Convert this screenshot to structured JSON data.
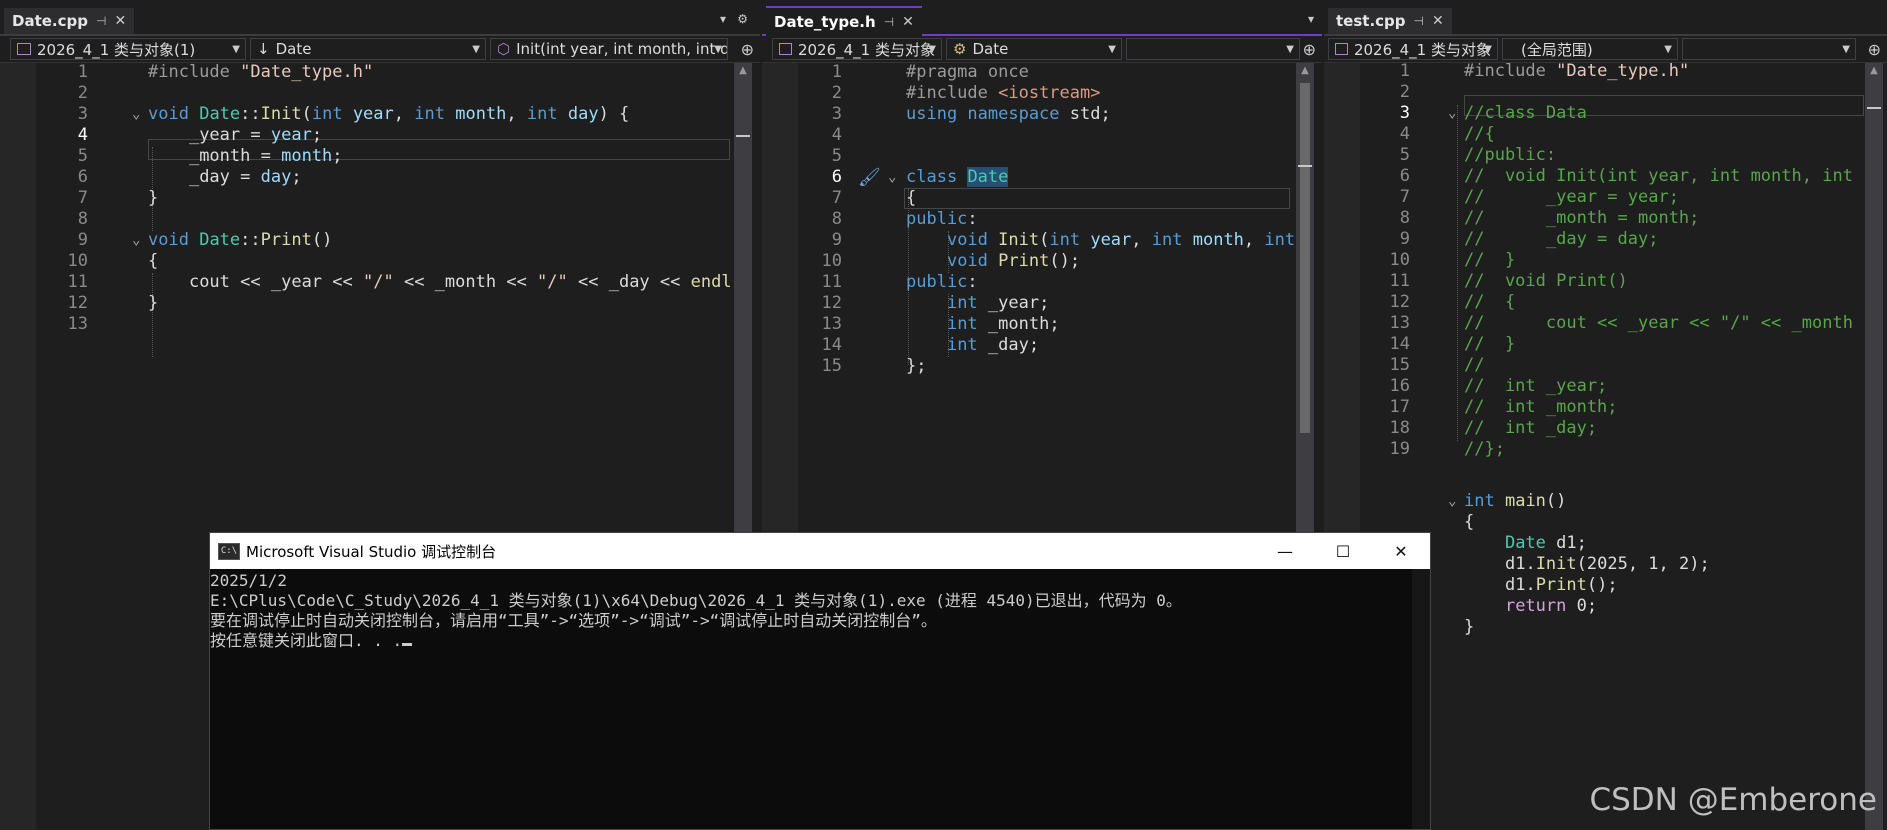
{
  "pane1": {
    "tab_title": "Date.cpp",
    "nav": {
      "project": "2026_4_1 类与对象(1)",
      "scope": "Date",
      "member": "Init(int year, int month, int d"
    },
    "lines": [
      {
        "n": "1",
        "t": "#include \"Date_type.h\""
      },
      {
        "n": "2",
        "t": ""
      },
      {
        "n": "3",
        "t": "void Date::Init(int year, int month, int day) {"
      },
      {
        "n": "4",
        "t": "    _year = year;"
      },
      {
        "n": "5",
        "t": "    _month = month;"
      },
      {
        "n": "6",
        "t": "    _day = day;"
      },
      {
        "n": "7",
        "t": "}"
      },
      {
        "n": "8",
        "t": ""
      },
      {
        "n": "9",
        "t": "void Date::Print()"
      },
      {
        "n": "10",
        "t": "{"
      },
      {
        "n": "11",
        "t": "    cout << _year << \"/\" << _month << \"/\" << _day << endl"
      },
      {
        "n": "12",
        "t": "}"
      },
      {
        "n": "13",
        "t": ""
      }
    ]
  },
  "pane2": {
    "tab_title": "Date_type.h",
    "nav": {
      "project": "2026_4_1 类与对象",
      "scope": "Date",
      "member": ""
    },
    "lines": [
      {
        "n": "1",
        "t": "#pragma once"
      },
      {
        "n": "2",
        "t": "#include <iostream>"
      },
      {
        "n": "3",
        "t": "using namespace std;"
      },
      {
        "n": "4",
        "t": ""
      },
      {
        "n": "5",
        "t": ""
      },
      {
        "n": "6",
        "t": "class Date"
      },
      {
        "n": "7",
        "t": "{"
      },
      {
        "n": "8",
        "t": "public:"
      },
      {
        "n": "9",
        "t": "    void Init(int year, int month, int"
      },
      {
        "n": "10",
        "t": "    void Print();"
      },
      {
        "n": "11",
        "t": "public:"
      },
      {
        "n": "12",
        "t": "    int _year;"
      },
      {
        "n": "13",
        "t": "    int _month;"
      },
      {
        "n": "14",
        "t": "    int _day;"
      },
      {
        "n": "15",
        "t": "};"
      }
    ]
  },
  "pane3": {
    "tab_title": "test.cpp",
    "nav": {
      "project": "2026_4_1 类与对象",
      "scope": "(全局范围)",
      "member": ""
    },
    "lines": [
      {
        "n": "1",
        "t": "#include \"Date_type.h\""
      },
      {
        "n": "2",
        "t": ""
      },
      {
        "n": "3",
        "t": "//class Data"
      },
      {
        "n": "4",
        "t": "//{"
      },
      {
        "n": "5",
        "t": "//public:"
      },
      {
        "n": "6",
        "t": "//  void Init(int year, int month, int"
      },
      {
        "n": "7",
        "t": "//      _year = year;"
      },
      {
        "n": "8",
        "t": "//      _month = month;"
      },
      {
        "n": "9",
        "t": "//      _day = day;"
      },
      {
        "n": "10",
        "t": "//  }"
      },
      {
        "n": "11",
        "t": "//  void Print()"
      },
      {
        "n": "12",
        "t": "//  {"
      },
      {
        "n": "13",
        "t": "//      cout << _year << \"/\" << _month"
      },
      {
        "n": "14",
        "t": "//  }"
      },
      {
        "n": "15",
        "t": "//"
      },
      {
        "n": "16",
        "t": "//  int _year;"
      },
      {
        "n": "17",
        "t": "//  int _month;"
      },
      {
        "n": "18",
        "t": "//  int _day;"
      },
      {
        "n": "19",
        "t": "//};"
      }
    ],
    "main_lines": [
      "int main()",
      "{",
      "    Date d1;",
      "    d1.Init(2025, 1, 2);",
      "    d1.Print();",
      "    return 0;",
      "}"
    ]
  },
  "console": {
    "title": "Microsoft Visual Studio 调试控制台",
    "icon_label": "C:\\",
    "output": [
      "2025/1/2",
      "",
      "E:\\CPlus\\Code\\C_Study\\2026_4_1 类与对象(1)\\x64\\Debug\\2026_4_1 类与对象(1).exe (进程 4540)已退出，代码为 0。",
      "要在调试停止时自动关闭控制台，请启用“工具”->“选项”->“调试”->“调试停止时自动关闭控制台”。",
      "按任意键关闭此窗口. . ."
    ],
    "minimize": "—",
    "maximize": "☐",
    "close": "✕"
  },
  "watermark": "CSDN @Emberone"
}
